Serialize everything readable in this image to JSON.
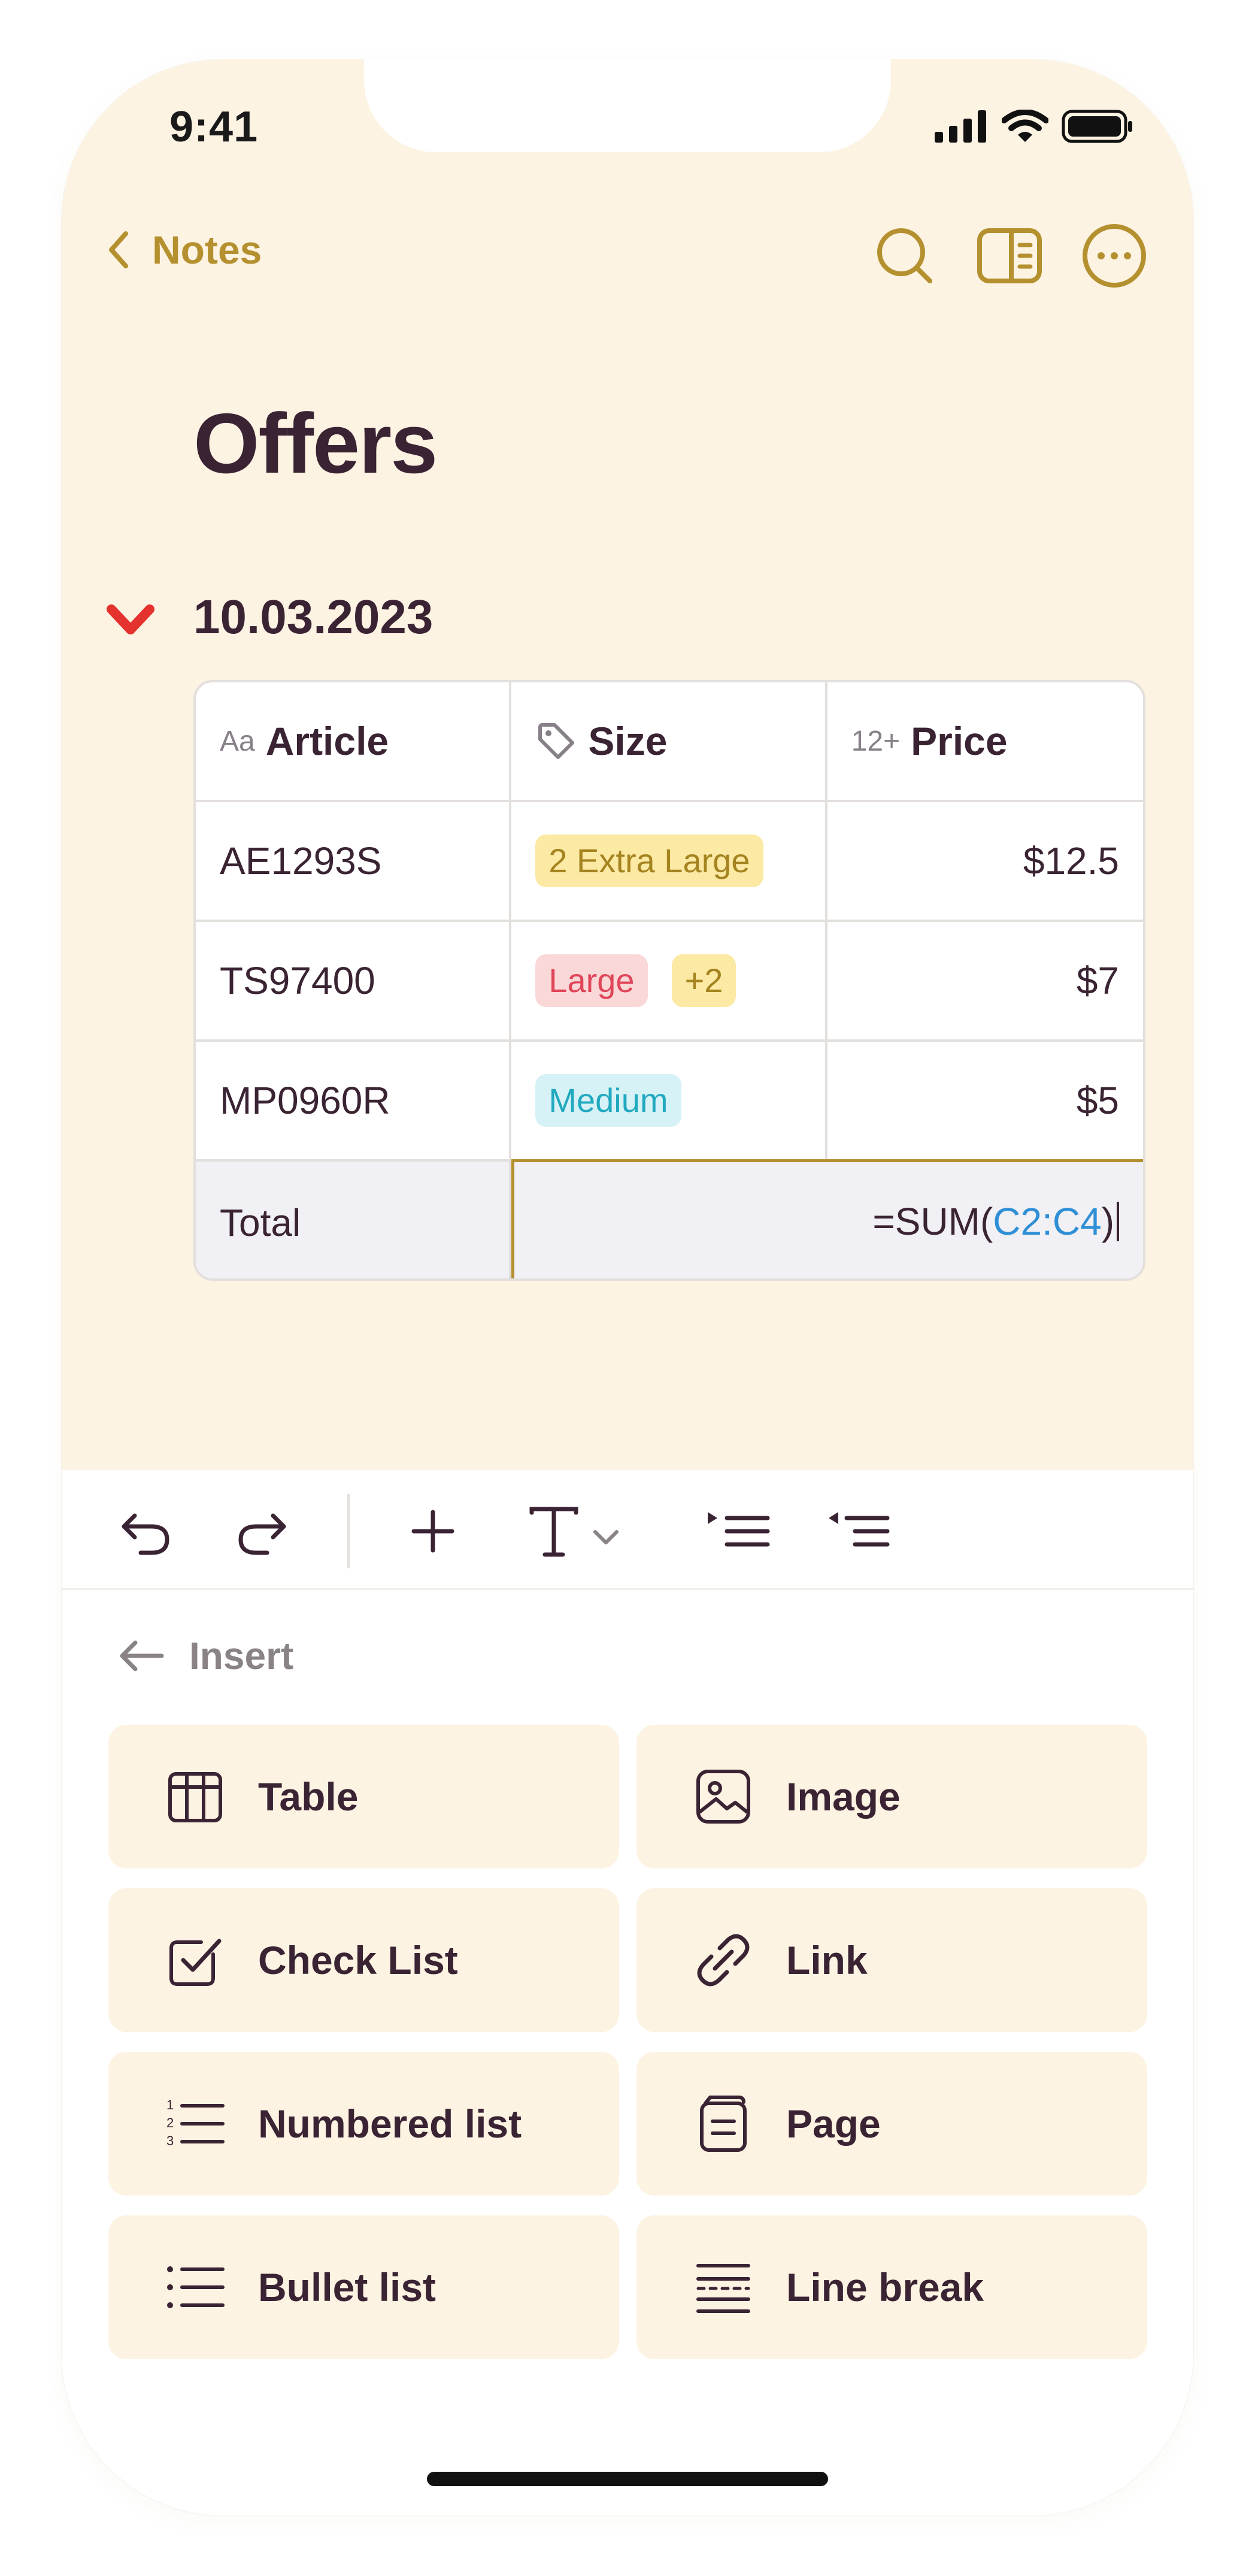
{
  "status_bar": {
    "time": "9:41"
  },
  "nav": {
    "back_label": "Notes"
  },
  "page": {
    "title": "Offers",
    "section_date": "10.03.2023"
  },
  "table": {
    "headers": [
      {
        "prefix": "Aa",
        "label": "Article"
      },
      {
        "prefix": "",
        "label": "Size"
      },
      {
        "prefix": "12+",
        "label": "Price"
      }
    ],
    "rows": [
      {
        "article": "AE1293S",
        "tags": [
          "2 Extra Large"
        ],
        "price": "$12.5"
      },
      {
        "article": "TS97400",
        "tags": [
          "Large",
          "+2"
        ],
        "price": "$7"
      },
      {
        "article": "MP0960R",
        "tags": [
          "Medium"
        ],
        "price": "$5"
      }
    ],
    "total": {
      "label": "Total",
      "formula_prefix": "=SUM(",
      "formula_ref": "C2:C4",
      "formula_suffix": ")"
    }
  },
  "insert_panel": {
    "back_label": "Insert",
    "items": [
      {
        "label": "Table",
        "icon": "table-icon"
      },
      {
        "label": "Image",
        "icon": "image-icon"
      },
      {
        "label": "Check List",
        "icon": "checklist-icon"
      },
      {
        "label": "Link",
        "icon": "link-icon"
      },
      {
        "label": "Numbered list",
        "icon": "numbered-list-icon"
      },
      {
        "label": "Page",
        "icon": "page-icon"
      },
      {
        "label": "Bullet list",
        "icon": "bullet-list-icon"
      },
      {
        "label": "Line break",
        "icon": "line-break-icon"
      }
    ]
  },
  "colors": {
    "accent": "#b4902f",
    "background": "#fdf3e3",
    "text": "#3a2333",
    "tag_yellow": "#fbe9a4",
    "tag_red": "#fbd8d8",
    "tag_cyan": "#d6f2f6",
    "formula_ref": "#2f8fd6"
  }
}
